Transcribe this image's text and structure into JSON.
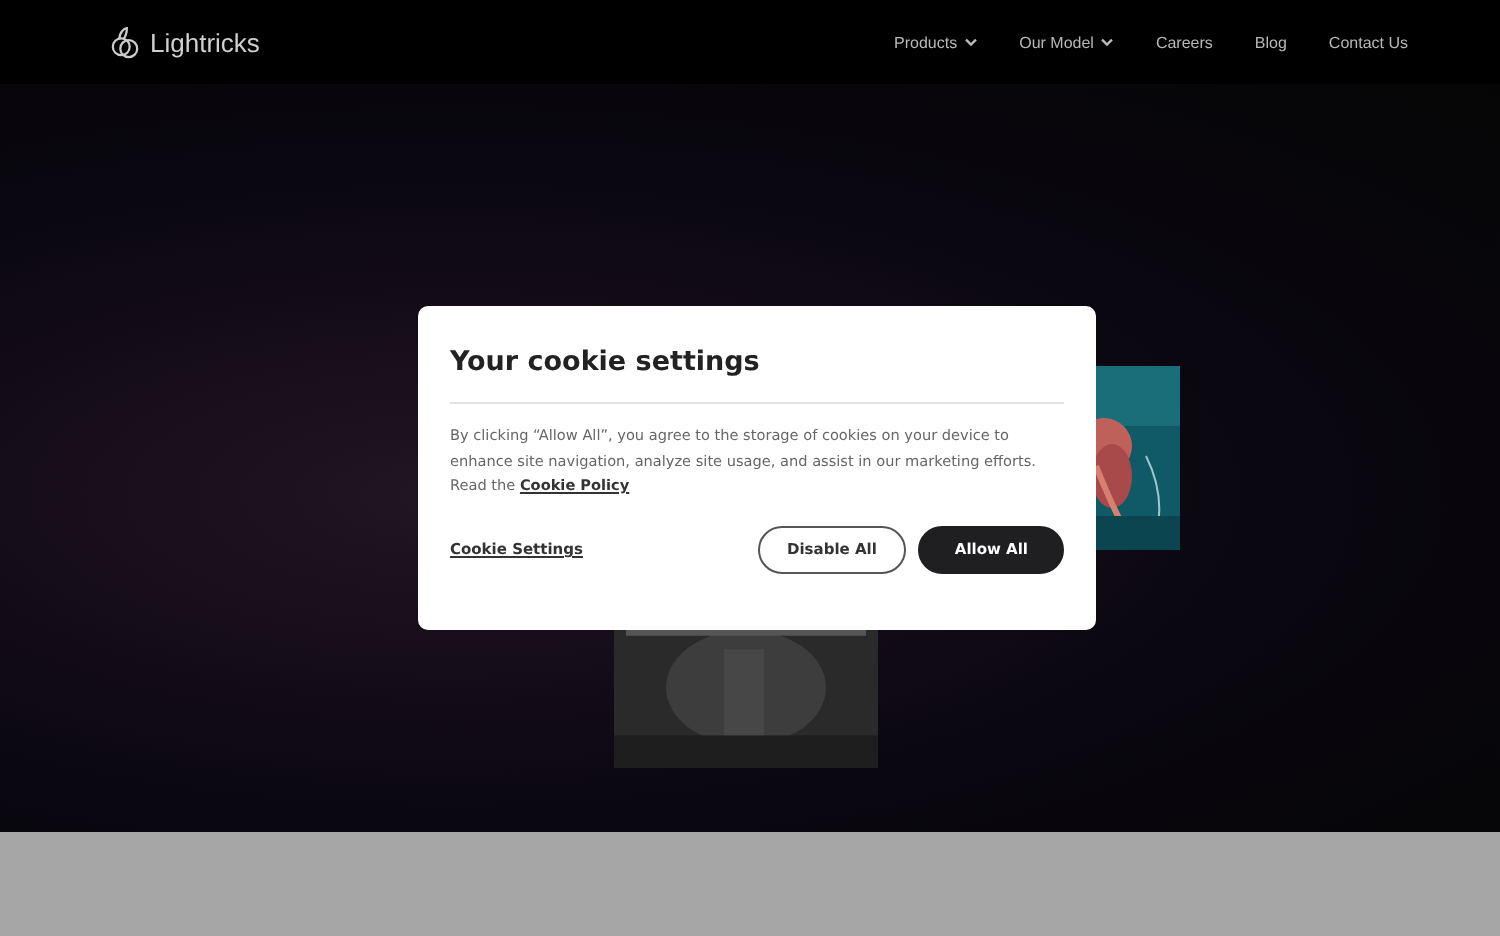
{
  "header": {
    "brand": "Lightricks",
    "nav": [
      {
        "label": "Products",
        "dropdown": true
      },
      {
        "label": "Our Model",
        "dropdown": true
      },
      {
        "label": "Careers",
        "dropdown": false
      },
      {
        "label": "Blog",
        "dropdown": false
      },
      {
        "label": "Contact Us",
        "dropdown": false
      }
    ]
  },
  "cookie_dialog": {
    "title": "Your cookie settings",
    "text": "By clicking “Allow All”, you agree to the storage of cookies on your device to enhance site navigation, analyze site usage, and assist in our marketing efforts. Read the ",
    "policy_link": "Cookie Policy",
    "settings_link": "Cookie Settings",
    "buttons": [
      {
        "label": "Disable All",
        "kind": "outline"
      },
      {
        "label": "Allow All",
        "kind": "filled"
      }
    ]
  }
}
